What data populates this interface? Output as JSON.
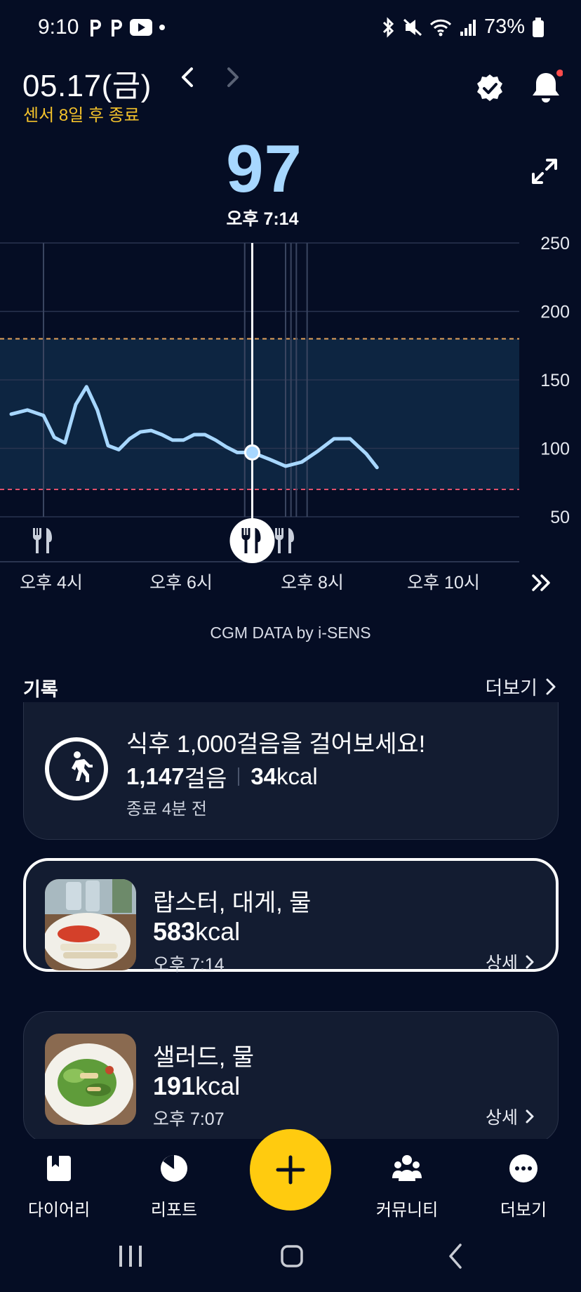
{
  "status_bar": {
    "time": "9:10",
    "battery": "73%",
    "left_icons": [
      "p-icon",
      "p-icon",
      "youtube-icon",
      "dot-icon"
    ],
    "right_icons": [
      "bluetooth-icon",
      "mute-icon",
      "wifi-icon",
      "signal-icon",
      "battery-icon"
    ]
  },
  "header": {
    "date": "05.17(금)",
    "sensor_note": "센서 8일 후 종료",
    "prev_icon": "chevron-left-icon",
    "next_icon": "chevron-right-icon"
  },
  "current": {
    "value": "97",
    "time": "오후 7:14"
  },
  "chart_data": {
    "type": "line",
    "x": [
      "오후 3:30",
      "오후 3:45",
      "오후 4:00",
      "오후 4:10",
      "오후 4:20",
      "오후 4:30",
      "오후 4:40",
      "오후 4:50",
      "오후 5:00",
      "오후 5:10",
      "오후 5:20",
      "오후 5:30",
      "오후 5:40",
      "오후 5:50",
      "오후 6:00",
      "오후 6:10",
      "오후 6:20",
      "오후 6:30",
      "오후 6:40",
      "오후 6:50",
      "오후 7:00",
      "오후 7:07",
      "오후 7:14",
      "오후 7:30",
      "오후 7:45",
      "오후 8:00",
      "오후 8:15",
      "오후 8:30",
      "오후 8:45",
      "오후 9:00",
      "오후 9:10"
    ],
    "values": [
      125,
      128,
      124,
      108,
      104,
      132,
      145,
      128,
      102,
      99,
      107,
      112,
      113,
      110,
      106,
      106,
      110,
      110,
      106,
      101,
      97,
      97,
      97,
      92,
      87,
      90,
      98,
      107,
      107,
      96,
      86
    ],
    "ylim": [
      50,
      250
    ],
    "yticks": [
      "250",
      "200",
      "150",
      "100",
      "50"
    ],
    "xticks": [
      "오후 4시",
      "오후 6시",
      "오후 8시",
      "오후 10시"
    ],
    "target_range": [
      70,
      180
    ],
    "markers": [
      "오후 4:00 식사",
      "오후 7:14 식사",
      "오후 7:45 식사"
    ],
    "selected_point": {
      "x": "오후 7:14",
      "y": 97
    },
    "line_color": "#a7d7ff",
    "range_color": "#0f2a47",
    "high_line_color": "#e3a15a",
    "low_line_color": "#e0506a"
  },
  "chart_labels": {
    "credit": "CGM DATA by i-SENS",
    "forward_icon": "double-chevron-right-icon"
  },
  "records": {
    "title": "기록",
    "more": "더보기"
  },
  "steps_card": {
    "title": "식후 1,000걸음을 걸어보세요!",
    "steps": "1,147",
    "steps_unit": "걸음",
    "kcal": "34",
    "kcal_unit": "kcal",
    "time": "종료 4분 전"
  },
  "meals": [
    {
      "name": "랍스터, 대게, 물",
      "kcal": "583",
      "kcal_unit": "kcal",
      "time": "오후 7:14",
      "detail": "상세"
    },
    {
      "name": "샐러드, 물",
      "kcal": "191",
      "kcal_unit": "kcal",
      "time": "오후 7:07",
      "detail": "상세"
    }
  ],
  "bottom_nav": {
    "diary": "다이어리",
    "report": "리포트",
    "community": "커뮤니티",
    "more": "더보기"
  }
}
